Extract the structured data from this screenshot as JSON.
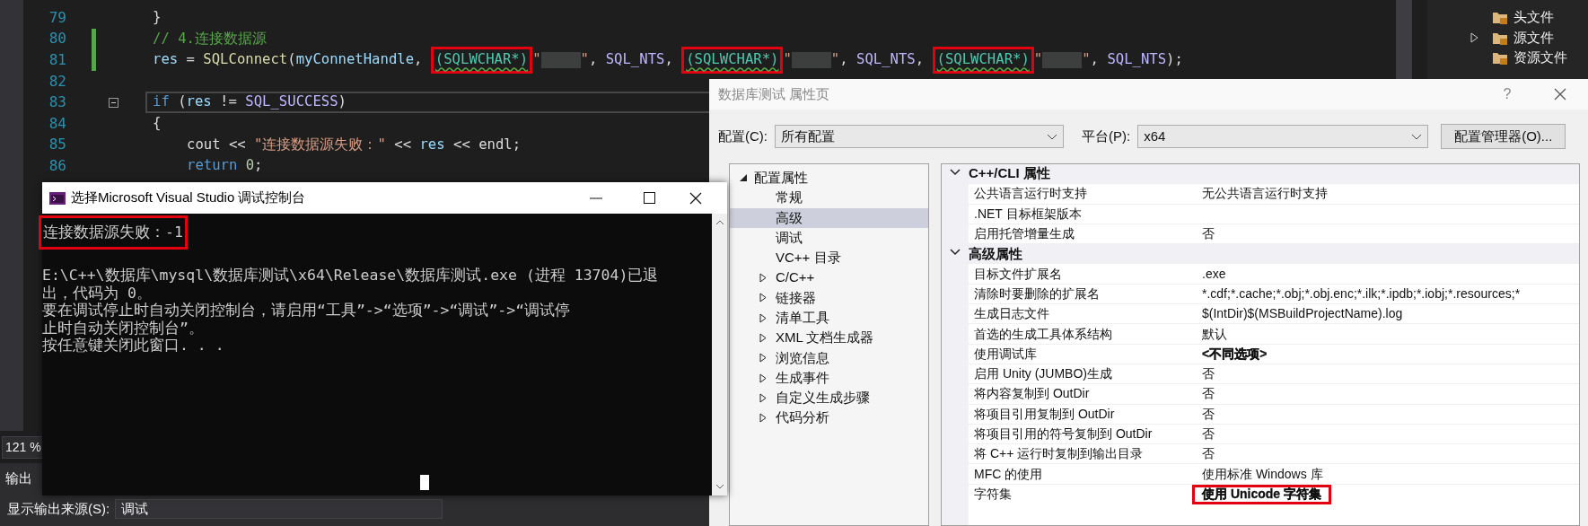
{
  "editor": {
    "lines": [
      {
        "number": "79",
        "modified": false,
        "current": false,
        "foldable": false,
        "tokens": [
          {
            "text": "}",
            "kind": "plain"
          }
        ]
      },
      {
        "number": "80",
        "modified": true,
        "current": false,
        "foldable": false,
        "tokens": [
          {
            "text": "// 4.连接数据源",
            "kind": "comment"
          }
        ]
      },
      {
        "number": "81",
        "modified": true,
        "current": false,
        "foldable": false,
        "tokens": [
          {
            "text": "res",
            "kind": "var"
          },
          {
            "text": " = ",
            "kind": "plain"
          },
          {
            "text": "SQLConnect",
            "kind": "func"
          },
          {
            "text": "(",
            "kind": "plain"
          },
          {
            "text": "myConnetHandle",
            "kind": "var"
          },
          {
            "text": ", ",
            "kind": "plain"
          },
          {
            "text": "(SQLWCHAR*)",
            "kind": "type",
            "highlighted": true,
            "squiggle": true
          },
          {
            "text": "\"",
            "kind": "string"
          },
          {
            "kind": "redacted"
          },
          {
            "text": "\"",
            "kind": "string"
          },
          {
            "text": ", ",
            "kind": "plain"
          },
          {
            "text": "SQL_NTS",
            "kind": "macro"
          },
          {
            "text": ", ",
            "kind": "plain"
          },
          {
            "text": "(SQLWCHAR*)",
            "kind": "type",
            "highlighted": true,
            "squiggle": true
          },
          {
            "text": "\"",
            "kind": "string"
          },
          {
            "kind": "redacted"
          },
          {
            "text": "\"",
            "kind": "string"
          },
          {
            "text": ", ",
            "kind": "plain"
          },
          {
            "text": "SQL_NTS",
            "kind": "macro"
          },
          {
            "text": ", ",
            "kind": "plain"
          },
          {
            "text": "(SQLWCHAR*)",
            "kind": "type",
            "highlighted": true,
            "squiggle": true
          },
          {
            "text": "\"",
            "kind": "string"
          },
          {
            "kind": "redacted"
          },
          {
            "text": "\"",
            "kind": "string"
          },
          {
            "text": ", ",
            "kind": "plain"
          },
          {
            "text": "SQL_NTS",
            "kind": "macro"
          },
          {
            "text": ");",
            "kind": "plain"
          }
        ]
      },
      {
        "number": "82",
        "modified": false,
        "current": false,
        "foldable": false
      },
      {
        "number": "83",
        "modified": false,
        "current": true,
        "foldable": true,
        "tokens": [
          {
            "text": "if",
            "kind": "keyword"
          },
          {
            "text": " (",
            "kind": "plain"
          },
          {
            "text": "res",
            "kind": "var"
          },
          {
            "text": " != ",
            "kind": "plain"
          },
          {
            "text": "SQL_SUCCESS",
            "kind": "macro"
          },
          {
            "text": ")",
            "kind": "plain"
          }
        ]
      },
      {
        "number": "84",
        "modified": false,
        "current": false,
        "foldable": false,
        "tokens": [
          {
            "text": "{",
            "kind": "plain"
          }
        ]
      },
      {
        "number": "85",
        "modified": false,
        "current": false,
        "foldable": false,
        "indented": true,
        "tokens": [
          {
            "text": "cout << ",
            "kind": "plain"
          },
          {
            "text": "\"连接数据源失败：\"",
            "kind": "string"
          },
          {
            "text": " << ",
            "kind": "plain"
          },
          {
            "text": "res",
            "kind": "var"
          },
          {
            "text": " << endl;",
            "kind": "plain"
          }
        ]
      },
      {
        "number": "86",
        "modified": false,
        "current": false,
        "foldable": false,
        "indented": true,
        "tokens": [
          {
            "text": "return ",
            "kind": "keyword"
          },
          {
            "text": "0",
            "kind": "number"
          },
          {
            "text": ";",
            "kind": "plain"
          }
        ]
      }
    ],
    "zoom": "121 %"
  },
  "solution_explorer": {
    "items": [
      {
        "label": "头文件",
        "expandable": false
      },
      {
        "label": "源文件",
        "expandable": true
      },
      {
        "label": "资源文件",
        "expandable": false
      }
    ]
  },
  "output_pane": {
    "tab": "输出",
    "source_label": "显示输出来源(S):",
    "source_value": "调试"
  },
  "console": {
    "title": "选择Microsoft Visual Studio 调试控制台",
    "lines": [
      {
        "text": "连接数据源失败：-1",
        "highlighted": true
      },
      {
        "highlighted": false
      },
      {
        "text": "E:\\C++\\数据库\\mysql\\数据库测试\\x64\\Release\\数据库测试.exe (进程 13704)已退",
        "highlighted": false
      },
      {
        "text": "出，代码为 0。",
        "highlighted": false
      },
      {
        "text": "要在调试停止时自动关闭控制台，请启用“工具”->“选项”->“调试”->“调试停",
        "highlighted": false
      },
      {
        "text": "止时自动关闭控制台”。",
        "highlighted": false
      },
      {
        "text": "按任意键关闭此窗口. . .",
        "highlighted": false
      }
    ]
  },
  "dialog": {
    "title": "数据库测试 属性页",
    "help": "?",
    "config_label": "配置(C):",
    "config_value": "所有配置",
    "platform_label": "平台(P):",
    "platform_value": "x64",
    "manager_button": "配置管理器(O)...",
    "tree": [
      {
        "label": "配置属性",
        "expanded": true,
        "selected": false,
        "children": [
          {
            "label": "常规",
            "selected": false
          },
          {
            "label": "高级",
            "selected": true
          },
          {
            "label": "调试",
            "selected": false
          },
          {
            "label": "VC++ 目录",
            "selected": false
          },
          {
            "label": "C/C++",
            "selected": false,
            "expanded": false
          },
          {
            "label": "链接器",
            "selected": false,
            "expanded": false
          },
          {
            "label": "清单工具",
            "selected": false,
            "expanded": false
          },
          {
            "label": "XML 文档生成器",
            "selected": false,
            "expanded": false
          },
          {
            "label": "浏览信息",
            "selected": false,
            "expanded": false
          },
          {
            "label": "生成事件",
            "selected": false,
            "expanded": false
          },
          {
            "label": "自定义生成步骤",
            "selected": false,
            "expanded": false
          },
          {
            "label": "代码分析",
            "selected": false,
            "expanded": false
          }
        ]
      }
    ],
    "grid": [
      {
        "kind": "category",
        "label": "C++/CLI 属性",
        "expanded": true
      },
      {
        "kind": "property",
        "name": "公共语言运行时支持",
        "value": "无公共语言运行时支持",
        "bold": false,
        "highlighted": false
      },
      {
        "kind": "property",
        "name": ".NET 目标框架版本"
      },
      {
        "kind": "property",
        "name": "启用托管增量生成",
        "value": "否",
        "bold": false,
        "highlighted": false
      },
      {
        "kind": "category",
        "label": "高级属性",
        "expanded": true
      },
      {
        "kind": "property",
        "name": "目标文件扩展名",
        "value": ".exe",
        "bold": false,
        "highlighted": false
      },
      {
        "kind": "property",
        "name": "清除时要删除的扩展名",
        "value": "*.cdf;*.cache;*.obj;*.obj.enc;*.ilk;*.ipdb;*.iobj;*.resources;*",
        "bold": false,
        "highlighted": false
      },
      {
        "kind": "property",
        "name": "生成日志文件",
        "value": "$(IntDir)$(MSBuildProjectName).log",
        "bold": false,
        "highlighted": false
      },
      {
        "kind": "property",
        "name": "首选的生成工具体系结构",
        "value": "默认",
        "bold": false,
        "highlighted": false
      },
      {
        "kind": "property",
        "name": "使用调试库",
        "value": "<不同选项>",
        "bold": true,
        "highlighted": false
      },
      {
        "kind": "property",
        "name": "启用 Unity (JUMBO)生成",
        "value": "否",
        "bold": false,
        "highlighted": false
      },
      {
        "kind": "property",
        "name": "将内容复制到 OutDir",
        "value": "否",
        "bold": false,
        "highlighted": false
      },
      {
        "kind": "property",
        "name": "将项目引用复制到 OutDir",
        "value": "否",
        "bold": false,
        "highlighted": false
      },
      {
        "kind": "property",
        "name": "将项目引用的符号复制到 OutDir",
        "value": "否",
        "bold": false,
        "highlighted": false
      },
      {
        "kind": "property",
        "name": "将 C++ 运行时复制到输出目录",
        "value": "否",
        "bold": false,
        "highlighted": false
      },
      {
        "kind": "property",
        "name": "MFC 的使用",
        "value": "使用标准 Windows 库",
        "bold": false,
        "highlighted": false
      },
      {
        "kind": "property",
        "name": "字符集",
        "value": "使用 Unicode 字符集",
        "bold": true,
        "highlighted": true
      }
    ]
  }
}
